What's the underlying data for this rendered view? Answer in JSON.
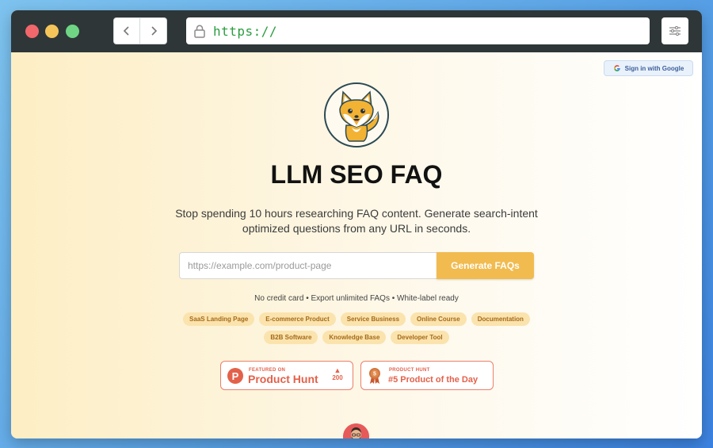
{
  "browser": {
    "url": "https://"
  },
  "page": {
    "signin_label": "Sign in with Google",
    "title": "LLM SEO FAQ",
    "subtitle": "Stop spending 10 hours researching FAQ content. Generate search-intent optimized questions from any URL in seconds.",
    "input_placeholder": "https://example.com/product-page",
    "generate_label": "Generate FAQs",
    "note": "No credit card • Export unlimited FAQs • White-label ready",
    "chips_row1": [
      "SaaS Landing Page",
      "E-commerce Product",
      "Service Business",
      "Online Course",
      "Documentation"
    ],
    "chips_row2": [
      "B2B Software",
      "Knowledge Base",
      "Developer Tool"
    ],
    "badge_featured": {
      "small": "FEATURED ON",
      "big": "Product Hunt",
      "votes": "200"
    },
    "badge_rank": {
      "small": "PRODUCT HUNT",
      "big": "#5 Product of the Day",
      "medal_number": "5"
    }
  },
  "colors": {
    "accent": "#f1bb4f",
    "product_hunt": "#e3614a",
    "url_green": "#2a9d3e"
  },
  "icons": [
    "back-icon",
    "forward-icon",
    "lock-icon",
    "sliders-icon",
    "google-icon",
    "fox-logo",
    "medal-icon",
    "upvote-icon"
  ]
}
